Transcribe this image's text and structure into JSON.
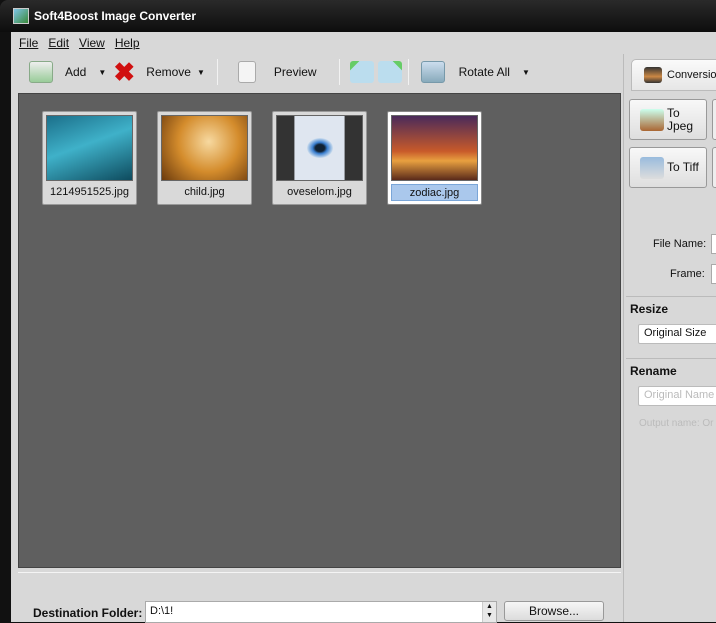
{
  "window": {
    "title": "Soft4Boost Image Converter"
  },
  "menu": [
    "File",
    "Edit",
    "View",
    "Help"
  ],
  "toolbar": {
    "add": "Add",
    "remove": "Remove",
    "preview": "Preview",
    "rotate_all": "Rotate All"
  },
  "files": [
    {
      "name": "1214951525.jpg",
      "selected": false
    },
    {
      "name": "child.jpg",
      "selected": false
    },
    {
      "name": "oveselom.jpg",
      "selected": false
    },
    {
      "name": "zodiac.jpg",
      "selected": true
    }
  ],
  "destination": {
    "label": "Destination Folder:",
    "value": "D:\\1!",
    "browse": "Browse..."
  },
  "panel": {
    "tab": "Conversion",
    "to_jpeg_1": "To",
    "to_jpeg_2": "Jpeg",
    "to_tiff": "To Tiff",
    "file_name_label": "File Name:",
    "frame_label": "Frame:",
    "resize_title": "Resize",
    "resize_value": "Original Size",
    "rename_title": "Rename",
    "rename_placeholder": "Original Name",
    "output_name": "Output name: Or"
  }
}
